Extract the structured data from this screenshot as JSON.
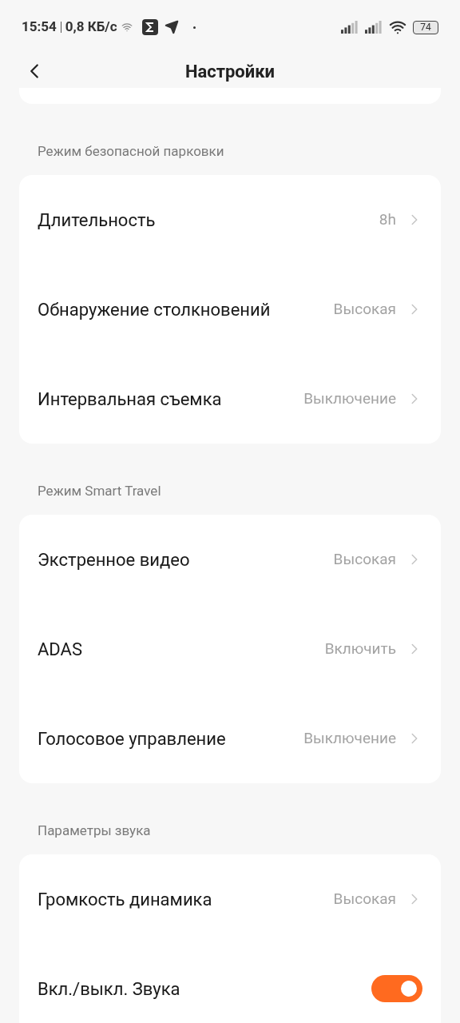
{
  "status_bar": {
    "time": "15:54",
    "speed": "0,8 КБ/с",
    "battery": "74"
  },
  "header": {
    "title": "Настройки"
  },
  "sections": [
    {
      "title": "Режим безопасной парковки",
      "items": [
        {
          "kind": "nav",
          "label": "Длительность",
          "value": "8h"
        },
        {
          "kind": "nav",
          "label": "Обнаружение столкновений",
          "value": "Высокая"
        },
        {
          "kind": "nav",
          "label": "Интервальная съемка",
          "value": "Выключение"
        }
      ]
    },
    {
      "title": "Режим Smart Travel",
      "items": [
        {
          "kind": "nav",
          "label": "Экстренное видео",
          "value": "Высокая"
        },
        {
          "kind": "nav",
          "label": "ADAS",
          "value": "Включить"
        },
        {
          "kind": "nav",
          "label": "Голосовое управление",
          "value": "Выключение"
        }
      ]
    },
    {
      "title": "Параметры звука",
      "items": [
        {
          "kind": "nav",
          "label": "Громкость динамика",
          "value": "Высокая"
        },
        {
          "kind": "switch",
          "label": "Вкл./выкл. Звука",
          "on": true
        }
      ]
    }
  ]
}
